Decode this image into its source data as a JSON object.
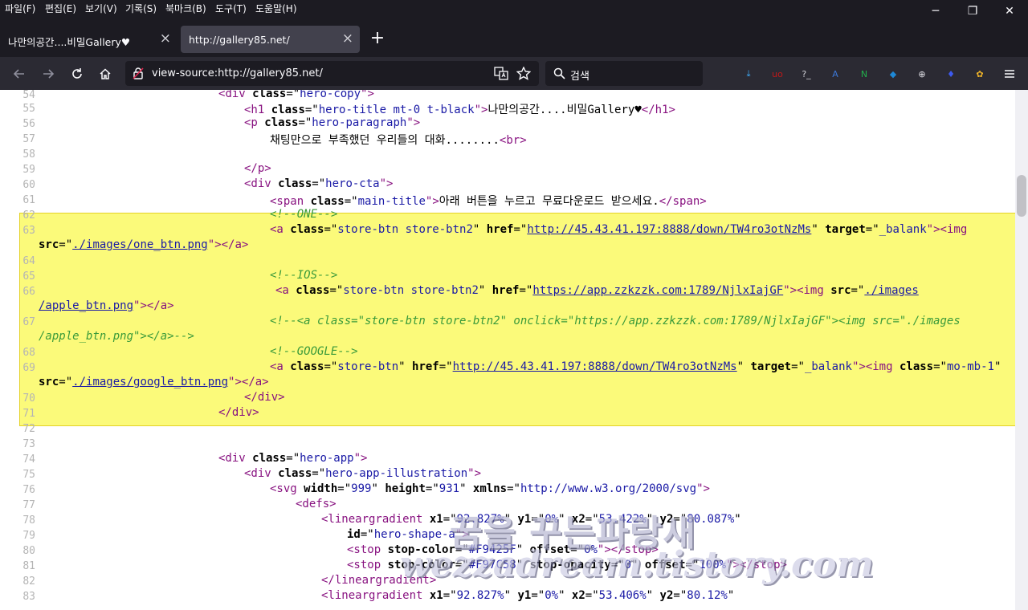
{
  "menubar": {
    "items": [
      "파일(F)",
      "편집(E)",
      "보기(V)",
      "기록(S)",
      "북마크(B)",
      "도구(T)",
      "도움말(H)"
    ]
  },
  "window_controls": {
    "minimize": "─",
    "restore": "❐",
    "close": "✕"
  },
  "tabs": [
    {
      "label": "나만의공간....비밀Gallery♥",
      "close": "×",
      "active": false
    },
    {
      "label": "http://gallery85.net/",
      "close": "×",
      "active": true
    }
  ],
  "new_tab": "+",
  "nav": {
    "url": "view-source:http://gallery85.net/",
    "search_placeholder": "검색",
    "extensions": [
      {
        "name": "download-icon",
        "glyph": "⤓",
        "color": "#3fb0ff"
      },
      {
        "name": "ublock-icon",
        "glyph": "uo",
        "color": "#c01818"
      },
      {
        "name": "terminal-icon",
        "glyph": "?_",
        "color": "#d0d0d6"
      },
      {
        "name": "translate-icon",
        "glyph": "A",
        "color": "#3c78d8"
      },
      {
        "name": "n-extension-icon",
        "glyph": "N",
        "color": "#22b14c"
      },
      {
        "name": "shield-extension-icon",
        "glyph": "◆",
        "color": "#1e88d6"
      },
      {
        "name": "globe-icon",
        "glyph": "⊕",
        "color": "#e0e0e6"
      },
      {
        "name": "gem-extension-icon",
        "glyph": "♦",
        "color": "#3d5af1"
      },
      {
        "name": "color-wheel-icon",
        "glyph": "✿",
        "color": "#f0b429"
      }
    ]
  },
  "code_lines": [
    {
      "n": "54",
      "spans": [
        {
          "t": "<",
          "c": "t"
        },
        {
          "t": "div",
          "c": "t"
        },
        {
          "t": " class",
          "c": "a"
        },
        {
          "t": "=\"",
          "c": ""
        },
        {
          "t": "hero-copy",
          "c": "v"
        },
        {
          "t": "\">",
          "c": "t"
        }
      ]
    },
    {
      "n": "55",
      "spans": [
        {
          "t": "<h1",
          "c": "t"
        },
        {
          "t": " class",
          "c": "a"
        },
        {
          "t": "=\"",
          "c": ""
        },
        {
          "t": "hero-title mt-0 t-black",
          "c": "v"
        },
        {
          "t": "\">",
          "c": "t"
        },
        {
          "t": "나만의공간....비밀Gallery♥",
          "c": ""
        },
        {
          "t": "</h1>",
          "c": "t"
        }
      ]
    },
    {
      "n": "56",
      "spans": [
        {
          "t": "<p",
          "c": "t"
        },
        {
          "t": " class",
          "c": "a"
        },
        {
          "t": "=\"",
          "c": ""
        },
        {
          "t": "hero-paragraph",
          "c": "v"
        },
        {
          "t": "\">",
          "c": "t"
        }
      ]
    },
    {
      "n": "57",
      "spans": [
        {
          "t": "채팅만으로 부족했던 우리들의 대화........",
          "c": ""
        },
        {
          "t": "<br>",
          "c": "t"
        }
      ]
    },
    {
      "n": "58",
      "spans": []
    },
    {
      "n": "59",
      "spans": [
        {
          "t": "</p>",
          "c": "t"
        }
      ]
    },
    {
      "n": "60",
      "spans": [
        {
          "t": "<div",
          "c": "t"
        },
        {
          "t": " class",
          "c": "a"
        },
        {
          "t": "=\"",
          "c": ""
        },
        {
          "t": "hero-cta",
          "c": "v"
        },
        {
          "t": "\">",
          "c": "t"
        }
      ]
    },
    {
      "n": "61",
      "spans": [
        {
          "t": "<span",
          "c": "t"
        },
        {
          "t": " class",
          "c": "a"
        },
        {
          "t": "=\"",
          "c": ""
        },
        {
          "t": "main-title",
          "c": "v"
        },
        {
          "t": "\">",
          "c": "t"
        },
        {
          "t": "아래 버튼을 누르고 무료다운로드 받으세요.",
          "c": ""
        },
        {
          "t": "</span>",
          "c": "t"
        }
      ]
    },
    {
      "n": "62",
      "spans": [
        {
          "t": "<!--ONE-->",
          "c": "c"
        }
      ]
    },
    {
      "n": "63",
      "spans": [
        {
          "t": "<a",
          "c": "t"
        },
        {
          "t": " class",
          "c": "a"
        },
        {
          "t": "=\"",
          "c": ""
        },
        {
          "t": "store-btn store-btn2",
          "c": "v"
        },
        {
          "t": "\"",
          "c": ""
        },
        {
          "t": " href",
          "c": "a"
        },
        {
          "t": "=\"",
          "c": ""
        },
        {
          "t": "http://45.43.41.197:8888/down/TW4ro3otNzMs",
          "c": "lk"
        },
        {
          "t": "\"",
          "c": ""
        },
        {
          "t": " target",
          "c": "a"
        },
        {
          "t": "=\"",
          "c": ""
        },
        {
          "t": "_balank",
          "c": "v"
        },
        {
          "t": "\">",
          "c": "t"
        },
        {
          "t": "<img",
          "c": "t"
        }
      ]
    },
    {
      "n": "",
      "spans": [
        {
          "t": "src",
          "c": "a"
        },
        {
          "t": "=\"",
          "c": ""
        },
        {
          "t": "./images/one_btn.png",
          "c": "lk"
        },
        {
          "t": "\">",
          "c": "t"
        },
        {
          "t": "</a>",
          "c": "t"
        }
      ]
    },
    {
      "n": "64",
      "spans": []
    },
    {
      "n": "65",
      "spans": [
        {
          "t": "<!--IOS-->",
          "c": "c"
        }
      ]
    },
    {
      "n": "66",
      "spans": [
        {
          "t": "<a",
          "c": "t"
        },
        {
          "t": " class",
          "c": "a"
        },
        {
          "t": "=\"",
          "c": ""
        },
        {
          "t": "store-btn store-btn2",
          "c": "v"
        },
        {
          "t": "\"",
          "c": ""
        },
        {
          "t": " href",
          "c": "a"
        },
        {
          "t": "=\"",
          "c": ""
        },
        {
          "t": "https://app.zzkzzk.com:1789/NjlxIajGF",
          "c": "lk"
        },
        {
          "t": "\">",
          "c": "t"
        },
        {
          "t": "<img",
          "c": "t"
        },
        {
          "t": " src",
          "c": "a"
        },
        {
          "t": "=\"",
          "c": ""
        },
        {
          "t": "./images",
          "c": "lk"
        }
      ]
    },
    {
      "n": "",
      "spans": [
        {
          "t": "/apple_btn.png",
          "c": "lk"
        },
        {
          "t": "\">",
          "c": "t"
        },
        {
          "t": "</a>",
          "c": "t"
        }
      ]
    },
    {
      "n": "67",
      "spans": [
        {
          "t": "<!--<a class=\"store-btn store-btn2\" onclick=\"https://app.zzkzzk.com:1789/NjlxIajGF\"><img src=\"./images",
          "c": "c"
        }
      ]
    },
    {
      "n": "",
      "spans": [
        {
          "t": "/apple_btn.png\"></a>-->",
          "c": "c"
        }
      ]
    },
    {
      "n": "68",
      "spans": [
        {
          "t": "<!--GOOGLE-->",
          "c": "c"
        }
      ]
    },
    {
      "n": "69",
      "spans": [
        {
          "t": "<a",
          "c": "t"
        },
        {
          "t": " class",
          "c": "a"
        },
        {
          "t": "=\"",
          "c": ""
        },
        {
          "t": "store-btn",
          "c": "v"
        },
        {
          "t": "\"",
          "c": ""
        },
        {
          "t": " href",
          "c": "a"
        },
        {
          "t": "=\"",
          "c": ""
        },
        {
          "t": "http://45.43.41.197:8888/down/TW4ro3otNzMs",
          "c": "lk"
        },
        {
          "t": "\"",
          "c": ""
        },
        {
          "t": " target",
          "c": "a"
        },
        {
          "t": "=\"",
          "c": ""
        },
        {
          "t": "_balank",
          "c": "v"
        },
        {
          "t": "\">",
          "c": "t"
        },
        {
          "t": "<img",
          "c": "t"
        },
        {
          "t": " class",
          "c": "a"
        },
        {
          "t": "=\"",
          "c": ""
        },
        {
          "t": "mo-mb-1",
          "c": "v"
        },
        {
          "t": "\"",
          "c": ""
        }
      ]
    },
    {
      "n": "",
      "spans": [
        {
          "t": "src",
          "c": "a"
        },
        {
          "t": "=\"",
          "c": ""
        },
        {
          "t": "./images/google_btn.png",
          "c": "lk"
        },
        {
          "t": "\">",
          "c": "t"
        },
        {
          "t": "</a>",
          "c": "t"
        }
      ]
    },
    {
      "n": "70",
      "spans": [
        {
          "t": "</div>",
          "c": "t"
        }
      ]
    },
    {
      "n": "71",
      "spans": [
        {
          "t": "</div>",
          "c": "t"
        }
      ]
    },
    {
      "n": "72",
      "spans": []
    },
    {
      "n": "73",
      "spans": []
    },
    {
      "n": "74",
      "spans": [
        {
          "t": "<div",
          "c": "t"
        },
        {
          "t": " class",
          "c": "a"
        },
        {
          "t": "=\"",
          "c": ""
        },
        {
          "t": "hero-app",
          "c": "v"
        },
        {
          "t": "\">",
          "c": "t"
        }
      ]
    },
    {
      "n": "75",
      "spans": [
        {
          "t": "<div",
          "c": "t"
        },
        {
          "t": " class",
          "c": "a"
        },
        {
          "t": "=\"",
          "c": ""
        },
        {
          "t": "hero-app-illustration",
          "c": "v"
        },
        {
          "t": "\">",
          "c": "t"
        }
      ]
    },
    {
      "n": "76",
      "spans": [
        {
          "t": "<svg",
          "c": "t"
        },
        {
          "t": " width",
          "c": "a"
        },
        {
          "t": "=\"",
          "c": ""
        },
        {
          "t": "999",
          "c": "v"
        },
        {
          "t": "\"",
          "c": ""
        },
        {
          "t": " height",
          "c": "a"
        },
        {
          "t": "=\"",
          "c": ""
        },
        {
          "t": "931",
          "c": "v"
        },
        {
          "t": "\"",
          "c": ""
        },
        {
          "t": " xmlns",
          "c": "a"
        },
        {
          "t": "=\"",
          "c": ""
        },
        {
          "t": "http://www.w3.org/2000/svg",
          "c": "v"
        },
        {
          "t": "\">",
          "c": "t"
        }
      ]
    },
    {
      "n": "77",
      "spans": [
        {
          "t": "<defs>",
          "c": "t"
        }
      ]
    },
    {
      "n": "78",
      "spans": [
        {
          "t": "<lineargradient",
          "c": "t"
        },
        {
          "t": " x1",
          "c": "a"
        },
        {
          "t": "=\"",
          "c": ""
        },
        {
          "t": "92.827%",
          "c": "v"
        },
        {
          "t": "\"",
          "c": ""
        },
        {
          "t": " y1",
          "c": "a"
        },
        {
          "t": "=\"",
          "c": ""
        },
        {
          "t": "0%",
          "c": "v"
        },
        {
          "t": "\"",
          "c": ""
        },
        {
          "t": " x2",
          "c": "a"
        },
        {
          "t": "=\"",
          "c": ""
        },
        {
          "t": "53.422%",
          "c": "v"
        },
        {
          "t": "\"",
          "c": ""
        },
        {
          "t": " y2",
          "c": "a"
        },
        {
          "t": "=\"",
          "c": ""
        },
        {
          "t": "80.087%",
          "c": "v"
        },
        {
          "t": "\"",
          "c": ""
        }
      ]
    },
    {
      "n": "79",
      "spans": [
        {
          "t": "id",
          "c": "a"
        },
        {
          "t": "=\"",
          "c": ""
        },
        {
          "t": "hero-shape-a",
          "c": "v"
        },
        {
          "t": "\">",
          "c": "t"
        }
      ]
    },
    {
      "n": "80",
      "spans": [
        {
          "t": "<stop",
          "c": "t"
        },
        {
          "t": " stop-color",
          "c": "a"
        },
        {
          "t": "=\"",
          "c": ""
        },
        {
          "t": "#F9425F",
          "c": "v"
        },
        {
          "t": "\"",
          "c": ""
        },
        {
          "t": " offset",
          "c": "a"
        },
        {
          "t": "=\"",
          "c": ""
        },
        {
          "t": "0%",
          "c": "v"
        },
        {
          "t": "\">",
          "c": "t"
        },
        {
          "t": "</stop>",
          "c": "t"
        }
      ]
    },
    {
      "n": "81",
      "spans": [
        {
          "t": "<stop",
          "c": "t"
        },
        {
          "t": " stop-color",
          "c": "a"
        },
        {
          "t": "=\"",
          "c": ""
        },
        {
          "t": "#F97C58",
          "c": "v"
        },
        {
          "t": "\"",
          "c": ""
        },
        {
          "t": " stop-opacity",
          "c": "a"
        },
        {
          "t": "=\"",
          "c": ""
        },
        {
          "t": "0",
          "c": "v"
        },
        {
          "t": "\"",
          "c": ""
        },
        {
          "t": " offset",
          "c": "a"
        },
        {
          "t": "=\"",
          "c": ""
        },
        {
          "t": "100%",
          "c": "v"
        },
        {
          "t": "\">",
          "c": "t"
        },
        {
          "t": "</stop>",
          "c": "t"
        }
      ]
    },
    {
      "n": "82",
      "spans": [
        {
          "t": "</lineargradient>",
          "c": "t"
        }
      ]
    },
    {
      "n": "83",
      "spans": [
        {
          "t": "<lineargradient",
          "c": "t"
        },
        {
          "t": " x1",
          "c": "a"
        },
        {
          "t": "=\"",
          "c": ""
        },
        {
          "t": "92.827%",
          "c": "v"
        },
        {
          "t": "\"",
          "c": ""
        },
        {
          "t": " y1",
          "c": "a"
        },
        {
          "t": "=\"",
          "c": ""
        },
        {
          "t": "0%",
          "c": "v"
        },
        {
          "t": "\"",
          "c": ""
        },
        {
          "t": " x2",
          "c": "a"
        },
        {
          "t": "=\"",
          "c": ""
        },
        {
          "t": "53.406%",
          "c": "v"
        },
        {
          "t": "\"",
          "c": ""
        },
        {
          "t": " y2",
          "c": "a"
        },
        {
          "t": "=\"",
          "c": ""
        },
        {
          "t": "80.12%",
          "c": "v"
        },
        {
          "t": "\"",
          "c": ""
        }
      ]
    }
  ],
  "watermark": {
    "title": "꿈을 꾸는파랑새",
    "url": "wezzadream.tistory.com"
  }
}
